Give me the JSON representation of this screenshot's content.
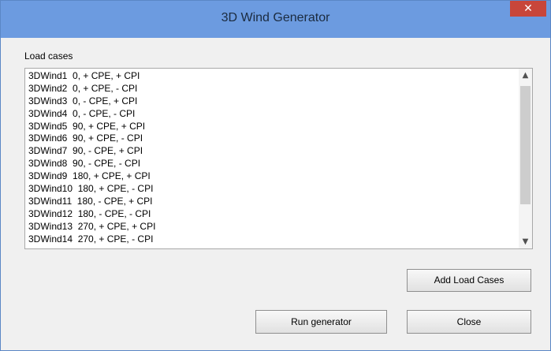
{
  "window": {
    "title": "3D Wind Generator",
    "close_glyph": "✕"
  },
  "load_cases": {
    "label": "Load cases",
    "items": [
      "3DWind1  0, + CPE, + CPI",
      "3DWind2  0, + CPE, - CPI",
      "3DWind3  0, - CPE, + CPI",
      "3DWind4  0, - CPE, - CPI",
      "3DWind5  90, + CPE, + CPI",
      "3DWind6  90, + CPE, - CPI",
      "3DWind7  90, - CPE, + CPI",
      "3DWind8  90, - CPE, - CPI",
      "3DWind9  180, + CPE, + CPI",
      "3DWind10  180, + CPE, - CPI",
      "3DWind11  180, - CPE, + CPI",
      "3DWind12  180, - CPE, - CPI",
      "3DWind13  270, + CPE, + CPI",
      "3DWind14  270, + CPE, - CPI"
    ],
    "scroll_up_glyph": "▲",
    "scroll_down_glyph": "▼"
  },
  "buttons": {
    "add_load_cases": "Add Load Cases",
    "run_generator": "Run generator",
    "close": "Close"
  },
  "colors": {
    "titlebar": "#6c9be0",
    "close_button": "#c8463a"
  }
}
